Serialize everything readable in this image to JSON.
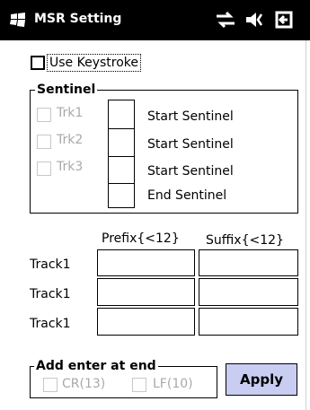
{
  "titlebar": {
    "title": "MSR Setting",
    "icons": [
      "windows-start-icon",
      "connectivity-icon",
      "volume-icon",
      "battery-icon"
    ]
  },
  "use_keystroke": {
    "label": "Use Keystroke",
    "checked": false
  },
  "sentinel": {
    "title": "Sentinel",
    "tracks": [
      {
        "label": "Trk1",
        "checked": false,
        "enabled": false
      },
      {
        "label": "Trk2",
        "checked": false,
        "enabled": false
      },
      {
        "label": "Trk3",
        "checked": false,
        "enabled": false
      }
    ],
    "rows": [
      {
        "label": "Start Sentinel",
        "value": ""
      },
      {
        "label": "Start Sentinel",
        "value": ""
      },
      {
        "label": "Start Sentinel",
        "value": ""
      },
      {
        "label": "End Sentinel",
        "value": ""
      }
    ]
  },
  "affix": {
    "prefix_header": "Prefix{<12}",
    "suffix_header": "Suffix{<12}",
    "rows": [
      {
        "label": "Track1",
        "prefix": "",
        "suffix": ""
      },
      {
        "label": "Track1",
        "prefix": "",
        "suffix": ""
      },
      {
        "label": "Track1",
        "prefix": "",
        "suffix": ""
      }
    ]
  },
  "add_enter": {
    "title": "Add enter at end",
    "options": [
      {
        "label": "CR(13)",
        "checked": false,
        "enabled": false
      },
      {
        "label": "LF(10)",
        "checked": false,
        "enabled": false
      }
    ]
  },
  "apply_label": "Apply",
  "colors": {
    "titlebar": "#000000",
    "apply_button": "#c9cdf1",
    "disabled_text": "#a9a9a9"
  }
}
